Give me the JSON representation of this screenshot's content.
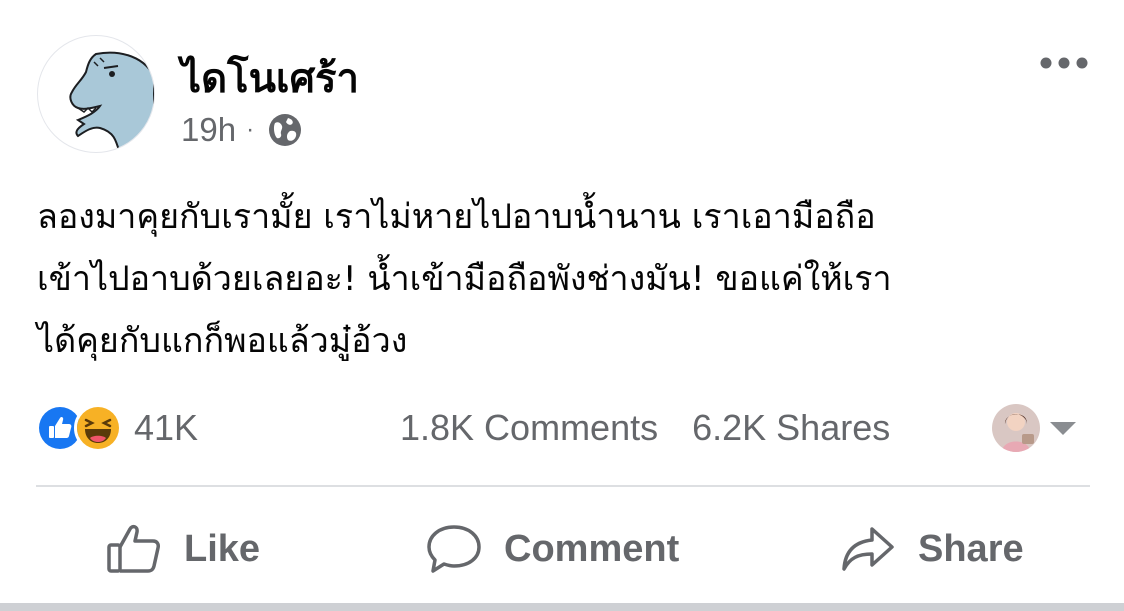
{
  "post": {
    "author": "ไดโนเศร้า",
    "time": "19h",
    "separator": "·",
    "privacy_icon": "globe-icon",
    "text_lines": [
      "ลองมาคุยกับเรามั้ย เราไม่หายไปอาบน้ำนาน เราเอามือถือ",
      "เข้าไปอาบด้วยเลยอะ! น้ำเข้ามือถือพังช่างมัน! ขอแค่ให้เรา",
      "ได้คุยกับแกก็พอแล้วมู๋อ้วง"
    ]
  },
  "stats": {
    "reaction_icons": [
      "like-reaction-icon",
      "haha-reaction-icon"
    ],
    "reactions": "41K",
    "comments": "1.8K Comments",
    "shares": "6.2K Shares"
  },
  "actions": {
    "like": "Like",
    "comment": "Comment",
    "share": "Share"
  },
  "colors": {
    "secondary_text": "#65676b",
    "like_blue": "#1877f2",
    "haha_yellow": "#f7b125",
    "avatar_dino": "#a9c8d8"
  }
}
